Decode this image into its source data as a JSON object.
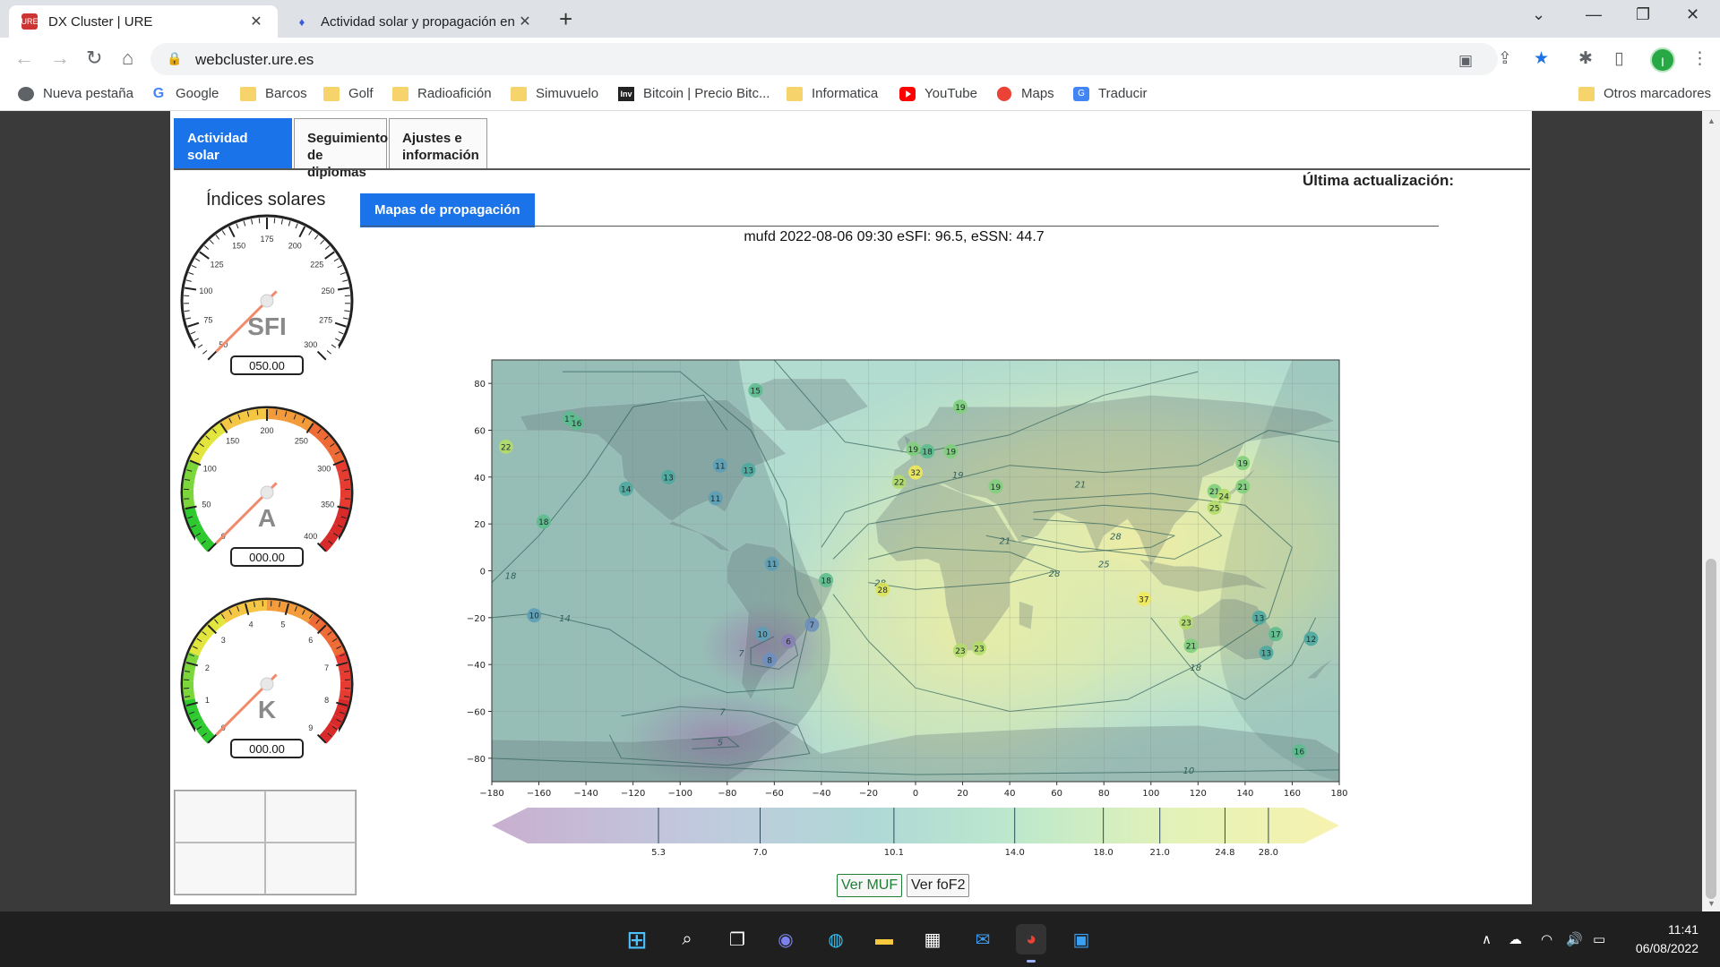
{
  "browser": {
    "tabs": [
      {
        "title": "DX Cluster | URE",
        "active": true
      },
      {
        "title": "Actividad solar y propagación en",
        "active": false
      }
    ],
    "new_tab": "+",
    "url": "webcluster.ure.es",
    "profile_initial": "I",
    "bookmarks": [
      {
        "label": "Nueva pestaña",
        "icon": "globe-icon"
      },
      {
        "label": "Google",
        "icon": "google-icon"
      },
      {
        "label": "Barcos",
        "icon": "folder-icon"
      },
      {
        "label": "Golf",
        "icon": "folder-icon"
      },
      {
        "label": "Radioafición",
        "icon": "folder-icon"
      },
      {
        "label": "Simuvuelo",
        "icon": "folder-icon"
      },
      {
        "label": "Bitcoin | Precio Bitc...",
        "icon": "investing-icon"
      },
      {
        "label": "Informatica",
        "icon": "folder-icon"
      },
      {
        "label": "YouTube",
        "icon": "youtube-icon"
      },
      {
        "label": "Maps",
        "icon": "maps-icon"
      },
      {
        "label": "Traducir",
        "icon": "translate-icon"
      }
    ],
    "other_bookmarks": "Otros marcadores"
  },
  "page": {
    "tabs": [
      "Actividad solar\ny propagación",
      "Seguimiento\nde diplomas",
      "Ajustes e\ninformación"
    ],
    "last_update_label": "Última actualización:",
    "indices_title": "Índices solares",
    "gauges": [
      {
        "id": "sfi",
        "label": "SFI",
        "value": "050.00",
        "min": 50,
        "max": 300,
        "ticks": [
          "50",
          "75",
          "100",
          "125",
          "150",
          "175",
          "200",
          "225",
          "250",
          "275",
          "300"
        ],
        "colored": false
      },
      {
        "id": "a",
        "label": "A",
        "value": "000.00",
        "min": 0,
        "max": 400,
        "ticks": [
          "0",
          "50",
          "100",
          "150",
          "200",
          "250",
          "300",
          "350",
          "400"
        ],
        "colored": true
      },
      {
        "id": "k",
        "label": "K",
        "value": "000.00",
        "min": 0,
        "max": 9,
        "ticks": [
          "0",
          "1",
          "2",
          "3",
          "4",
          "5",
          "6",
          "7",
          "8",
          "9"
        ],
        "colored": true
      }
    ],
    "subtab": "Mapas de propagación",
    "map_title": "mufd 2022-08-06 09:30 eSFI: 96.5, eSSN: 44.7",
    "buttons": {
      "muf": "Ver MUF",
      "fof2": "Ver foF2"
    }
  },
  "chart_data": {
    "type": "heatmap",
    "title": "mufd 2022-08-06 09:30 eSFI: 96.5, eSSN: 44.7",
    "xlim": [
      -180,
      180
    ],
    "ylim": [
      -90,
      90
    ],
    "x_ticks": [
      "−180",
      "−160",
      "−140",
      "−120",
      "−100",
      "−80",
      "−60",
      "−40",
      "−20",
      "0",
      "20",
      "40",
      "60",
      "80",
      "100",
      "120",
      "140",
      "160",
      "180"
    ],
    "y_ticks": [
      "80",
      "60",
      "40",
      "20",
      "0",
      "−20",
      "−40",
      "−60",
      "−80"
    ],
    "colorbar_ticks": [
      "5.3",
      "7.0",
      "10.1",
      "14.0",
      "18.0",
      "21.0",
      "24.8",
      "28.0"
    ],
    "contour_labels": [
      {
        "text": "7",
        "lon": -74,
        "lat": -35
      },
      {
        "text": "7",
        "lon": -82,
        "lat": -60
      },
      {
        "text": "5",
        "lon": -83,
        "lat": -73
      },
      {
        "text": "10",
        "lon": 116,
        "lat": -85
      },
      {
        "text": "14",
        "lon": -149,
        "lat": -20
      },
      {
        "text": "18",
        "lon": -172,
        "lat": -2
      },
      {
        "text": "19",
        "lon": 18,
        "lat": 41
      },
      {
        "text": "21",
        "lon": 70,
        "lat": 37
      },
      {
        "text": "21",
        "lon": 38,
        "lat": 13
      },
      {
        "text": "28",
        "lon": 85,
        "lat": 15
      },
      {
        "text": "25",
        "lon": 80,
        "lat": 3
      },
      {
        "text": "28",
        "lon": 59,
        "lat": -1
      },
      {
        "text": "28",
        "lon": -15,
        "lat": -5
      },
      {
        "text": "18",
        "lon": 119,
        "lat": -41
      }
    ],
    "stations": [
      {
        "value": 15,
        "lon": -68,
        "lat": 77
      },
      {
        "value": 19,
        "lon": 19,
        "lat": 70
      },
      {
        "value": 17,
        "lon": -147,
        "lat": 65
      },
      {
        "value": 16,
        "lon": -144,
        "lat": 63
      },
      {
        "value": 22,
        "lon": -174,
        "lat": 53
      },
      {
        "value": 19,
        "lon": -1,
        "lat": 52
      },
      {
        "value": 18,
        "lon": 5,
        "lat": 51
      },
      {
        "value": 19,
        "lon": 15,
        "lat": 51
      },
      {
        "value": 32,
        "lon": 0,
        "lat": 42
      },
      {
        "value": 22,
        "lon": -7,
        "lat": 38
      },
      {
        "value": 19,
        "lon": 34,
        "lat": 36
      },
      {
        "value": 19,
        "lon": 139,
        "lat": 46
      },
      {
        "value": 11,
        "lon": -83,
        "lat": 45
      },
      {
        "value": 13,
        "lon": -71,
        "lat": 43
      },
      {
        "value": 13,
        "lon": -105,
        "lat": 40
      },
      {
        "value": 14,
        "lon": -123,
        "lat": 35
      },
      {
        "value": 11,
        "lon": -85,
        "lat": 31
      },
      {
        "value": 21,
        "lon": 127,
        "lat": 34
      },
      {
        "value": 24,
        "lon": 131,
        "lat": 32
      },
      {
        "value": 21,
        "lon": 139,
        "lat": 36
      },
      {
        "value": 25,
        "lon": 127,
        "lat": 27
      },
      {
        "value": 18,
        "lon": -158,
        "lat": 21
      },
      {
        "value": 11,
        "lon": -61,
        "lat": 3
      },
      {
        "value": 18,
        "lon": -38,
        "lat": -4
      },
      {
        "value": 28,
        "lon": -14,
        "lat": -8
      },
      {
        "value": 37,
        "lon": 97,
        "lat": -12
      },
      {
        "value": 10,
        "lon": -162,
        "lat": -19
      },
      {
        "value": 7,
        "lon": -44,
        "lat": -23
      },
      {
        "value": 10,
        "lon": -65,
        "lat": -27
      },
      {
        "value": 6,
        "lon": -54,
        "lat": -30
      },
      {
        "value": 8,
        "lon": -62,
        "lat": -38
      },
      {
        "value": 23,
        "lon": 115,
        "lat": -22
      },
      {
        "value": 13,
        "lon": 146,
        "lat": -20
      },
      {
        "value": 17,
        "lon": 153,
        "lat": -27
      },
      {
        "value": 12,
        "lon": 168,
        "lat": -29
      },
      {
        "value": 21,
        "lon": 117,
        "lat": -32
      },
      {
        "value": 13,
        "lon": 149,
        "lat": -35
      },
      {
        "value": 23,
        "lon": 19,
        "lat": -34
      },
      {
        "value": 23,
        "lon": 27,
        "lat": -33
      },
      {
        "value": 16,
        "lon": 163,
        "lat": -77
      }
    ]
  },
  "taskbar": {
    "time": "11:41",
    "date": "06/08/2022"
  }
}
